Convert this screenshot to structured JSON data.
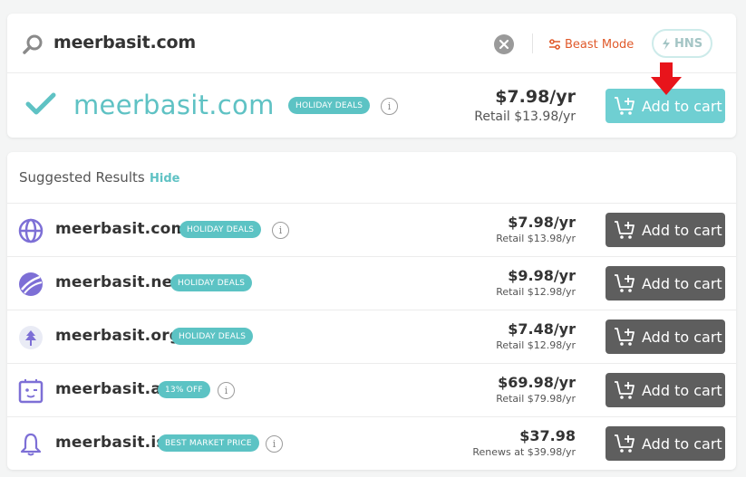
{
  "search": {
    "query": "meerbasit.com",
    "beast_mode_label": "Beast Mode",
    "hns_label": "HNS"
  },
  "main_result": {
    "domain": "meerbasit.com",
    "badge": "HOLIDAY DEALS",
    "price": "$7.98/yr",
    "retail": "Retail $13.98/yr",
    "cart_label": "Add to cart"
  },
  "suggested": {
    "title": "Suggested Results",
    "hide_label": "Hide",
    "rows": [
      {
        "domain": "meerbasit.com",
        "badge": "HOLIDAY DEALS",
        "price": "$7.98/yr",
        "retail": "Retail $13.98/yr",
        "cart_label": "Add to cart",
        "icon": "globe-icon"
      },
      {
        "domain": "meerbasit.net",
        "badge": "HOLIDAY DEALS",
        "price": "$9.98/yr",
        "retail": "Retail $12.98/yr",
        "cart_label": "Add to cart",
        "icon": "net-icon"
      },
      {
        "domain": "meerbasit.org",
        "badge": "HOLIDAY DEALS",
        "price": "$7.48/yr",
        "retail": "Retail $12.98/yr",
        "cart_label": "Add to cart",
        "icon": "org-tree-icon"
      },
      {
        "domain": "meerbasit.ai",
        "badge": "13% OFF",
        "price": "$69.98/yr",
        "retail": "Retail $79.98/yr",
        "cart_label": "Add to cart",
        "icon": "robot-icon"
      },
      {
        "domain": "meerbasit.is",
        "badge": "BEST MARKET PRICE",
        "price": "$37.98",
        "retail": "Renews at $39.98/yr",
        "cart_label": "Add to cart",
        "icon": "bell-icon"
      }
    ]
  },
  "colors": {
    "teal": "#5fc2c4",
    "cart_teal": "#6fcfd2",
    "cart_dark": "#5e5e5e",
    "beast_orange": "#e05a2b",
    "arrow_red": "#e8141b",
    "icon_purple": "#7d6fd6"
  }
}
